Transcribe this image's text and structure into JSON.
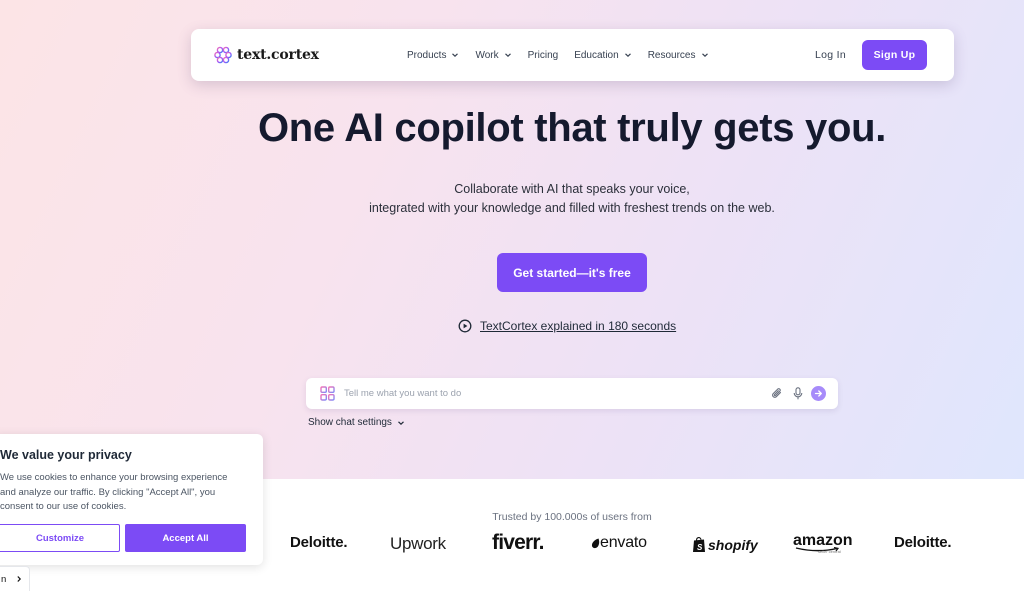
{
  "nav": {
    "logo_text": "text.cortex",
    "links": [
      {
        "label": "Products",
        "has_dropdown": true
      },
      {
        "label": "Work",
        "has_dropdown": true
      },
      {
        "label": "Pricing",
        "has_dropdown": false
      },
      {
        "label": "Education",
        "has_dropdown": true
      },
      {
        "label": "Resources",
        "has_dropdown": true
      }
    ],
    "login_label": "Log In",
    "signup_label": "Sign Up"
  },
  "hero": {
    "headline": "One AI copilot that truly gets you.",
    "subline_1": "Collaborate with AI that speaks your voice,",
    "subline_2": "integrated with your knowledge and filled with freshest trends on the web.",
    "cta_label": "Get started—it's free",
    "video_link_label": "TextCortex explained in 180 seconds"
  },
  "chat": {
    "value": "",
    "placeholder": "Tell me what you want to do",
    "settings_label": "Show chat settings",
    "icons": [
      "apps-grid-icon",
      "paperclip-icon",
      "microphone-icon",
      "send-arrow-icon"
    ]
  },
  "trusted": {
    "label": "Trusted by 100.000s of users from",
    "brands": [
      {
        "name": "Deloitte.",
        "extra": ""
      },
      {
        "name": "Upwork",
        "extra": ""
      },
      {
        "name": "fiverr.",
        "extra": ""
      },
      {
        "name": "envato",
        "extra": ""
      },
      {
        "name": "shopify",
        "extra": ""
      },
      {
        "name": "amazon",
        "extra": "seller central"
      },
      {
        "name": "Deloitte.",
        "extra": ""
      }
    ]
  },
  "cookie": {
    "title": "We value your privacy",
    "body": "We use cookies to enhance your browsing experience and analyze our traffic. By clicking \"Accept All\", you consent to our use of cookies.",
    "customize_label": "Customize",
    "accept_label": "Accept All"
  },
  "language_tab": {
    "label": "n"
  },
  "colors": {
    "accent": "#7c4bf5",
    "headline": "#151a2e"
  }
}
